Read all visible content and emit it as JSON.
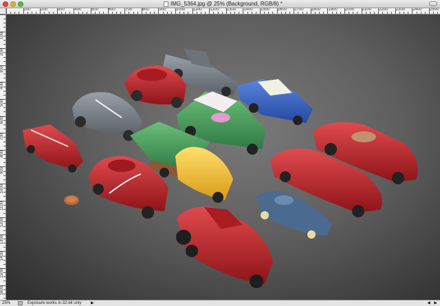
{
  "window": {
    "title": "IMG_5364.jpg @ 25% (Background, RGB/8) *"
  },
  "ruler": {
    "horizontal_labels": [
      "100",
      "200",
      "300",
      "400",
      "500",
      "600",
      "700",
      "800",
      "900",
      "1000",
      "1100",
      "1200",
      "1300",
      "1400",
      "1500",
      "1600",
      "1700",
      "1800",
      "1900",
      "2000",
      "2100",
      "2200",
      "2300",
      "2400",
      "2500"
    ],
    "vertical_labels": [
      "100",
      "200",
      "300",
      "400",
      "500",
      "600",
      "700",
      "800",
      "900",
      "1000",
      "1100",
      "1200",
      "1300",
      "1400",
      "1500",
      "1600"
    ]
  },
  "status": {
    "zoom": "25%",
    "message": "Exposure works in 32-bit only",
    "arrow": "▶"
  },
  "scroll": {
    "left": "◀",
    "right": "▶"
  },
  "image": {
    "subject": "Vintage die-cast toy cars arranged on grey cloth",
    "colors": {
      "background": "#5f5f5f",
      "red": "#c8242e",
      "blue": "#3366c8",
      "green": "#3a8e3a",
      "yellow": "#f2c52a",
      "gray": "#7a8088",
      "copper": "#b86a3a"
    }
  }
}
